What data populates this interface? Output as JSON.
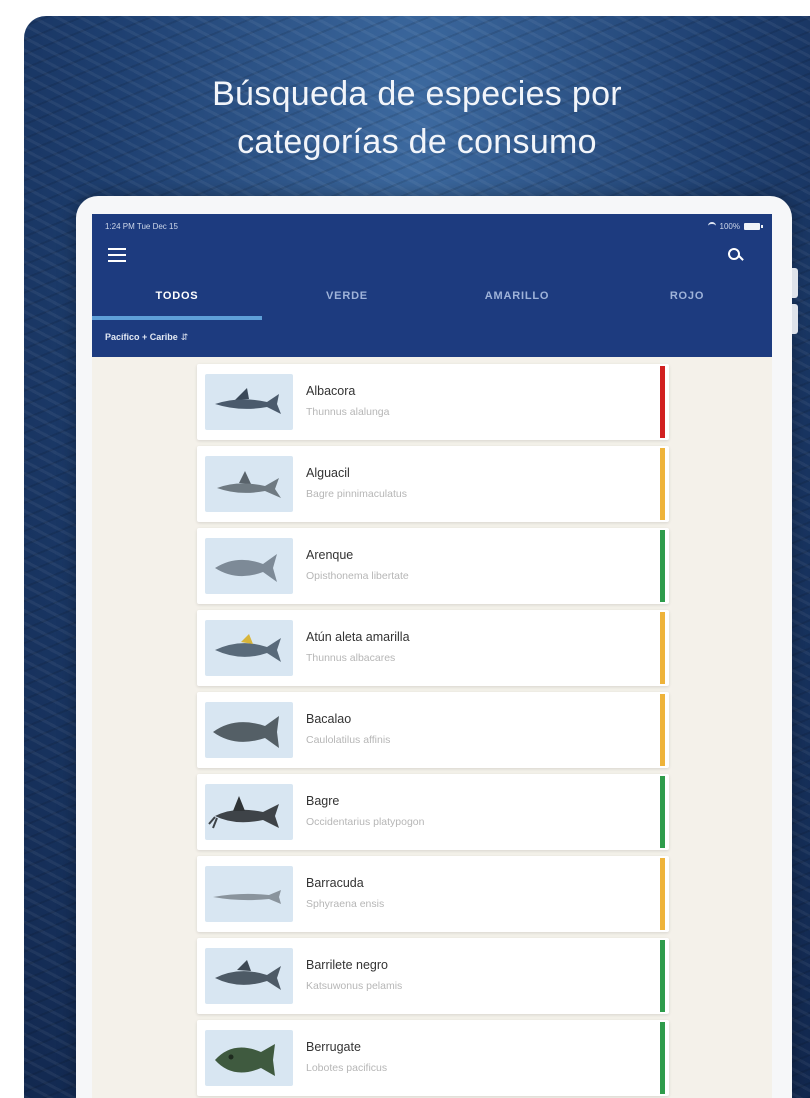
{
  "headline": {
    "line1": "Búsqueda de especies por",
    "line2": "categorías de consumo"
  },
  "status_bar": {
    "time": "1:24 PM  Tue Dec 15",
    "battery": "100%"
  },
  "tabs": [
    {
      "label": "TODOS",
      "active": true
    },
    {
      "label": "VERDE",
      "active": false
    },
    {
      "label": "AMARILLO",
      "active": false
    },
    {
      "label": "ROJO",
      "active": false
    }
  ],
  "region_filter": {
    "label": "Pacífico + Caribe",
    "icon": "chevron-updown-icon"
  },
  "icons": {
    "menu": "hamburger-menu-icon",
    "search": "search-icon"
  },
  "colors": {
    "appbar": "#1d3b7f",
    "tab_indicator": "#5e9fd8",
    "rojo": "#d12020",
    "amarillo": "#eeb33a",
    "verde": "#2e9c4b"
  },
  "species": [
    {
      "name": "Albacora",
      "scientific": "Thunnus alalunga",
      "category": "rojo"
    },
    {
      "name": "Alguacil",
      "scientific": "Bagre pinnimaculatus",
      "category": "amarillo"
    },
    {
      "name": "Arenque",
      "scientific": "Opisthonema libertate",
      "category": "verde"
    },
    {
      "name": "Atún aleta amarilla",
      "scientific": "Thunnus albacares",
      "category": "amarillo"
    },
    {
      "name": "Bacalao",
      "scientific": "Caulolatilus affinis",
      "category": "amarillo"
    },
    {
      "name": "Bagre",
      "scientific": "Occidentarius platypogon",
      "category": "verde"
    },
    {
      "name": "Barracuda",
      "scientific": "Sphyraena ensis",
      "category": "amarillo"
    },
    {
      "name": "Barrilete negro",
      "scientific": "Katsuwonus pelamis",
      "category": "verde"
    },
    {
      "name": "Berrugate",
      "scientific": "Lobotes pacificus",
      "category": "verde"
    }
  ]
}
